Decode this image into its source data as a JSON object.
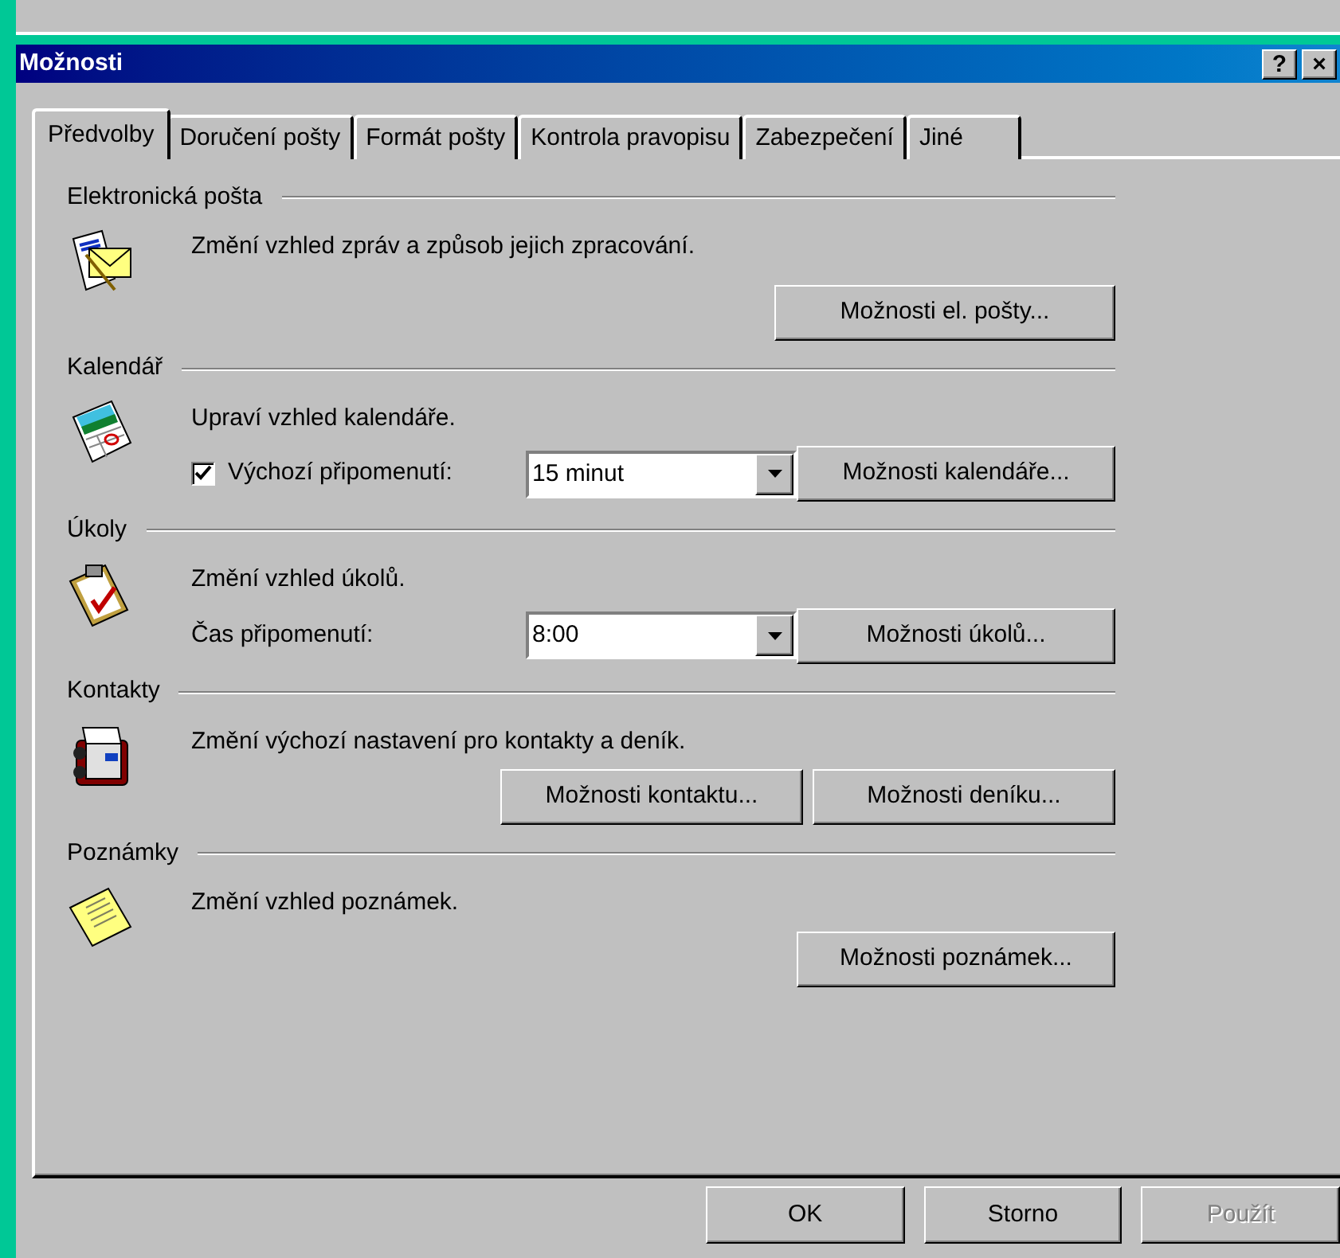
{
  "window": {
    "title": "Možnosti"
  },
  "title_buttons": [
    {
      "label": "?"
    },
    {
      "label": "×"
    }
  ],
  "tabs": [
    {
      "label": "Předvolby",
      "selected": true
    },
    {
      "label": "Doručení pošty",
      "selected": false
    },
    {
      "label": "Formát pošty",
      "selected": false
    },
    {
      "label": "Kontrola pravopisu",
      "selected": false
    },
    {
      "label": "Zabezpečení",
      "selected": false
    },
    {
      "label": "Jiné",
      "selected": false
    }
  ],
  "sections": [
    {
      "kind": "mail",
      "heading": "Elektronická pošta",
      "description": "Změní vzhled zpráv a způsob jejich zpracování.",
      "buttons": [
        {
          "label": "Možnosti el. pošty..."
        }
      ]
    },
    {
      "kind": "calendar",
      "heading": "Kalendář",
      "description": "Upraví vzhled kalendáře.",
      "reminder": {
        "kind": "checkbox",
        "label": "Výchozí připomenutí:",
        "checked": true,
        "value": "15 minut"
      },
      "buttons": [
        {
          "label": "Možnosti kalendáře..."
        }
      ]
    },
    {
      "kind": "tasks",
      "heading": "Úkoly",
      "description": "Změní vzhled úkolů.",
      "reminder": {
        "kind": "label",
        "label": "Čas připomenutí:",
        "value": "8:00"
      },
      "buttons": [
        {
          "label": "Možnosti úkolů..."
        }
      ]
    },
    {
      "kind": "contacts",
      "heading": "Kontakty",
      "description": "Změní výchozí nastavení pro kontakty a deník.",
      "buttons": [
        {
          "label": "Možnosti kontaktu..."
        },
        {
          "label": "Možnosti deníku..."
        }
      ]
    },
    {
      "kind": "notes",
      "heading": "Poznámky",
      "description": "Změní vzhled poznámek.",
      "buttons": [
        {
          "label": "Možnosti poznámek..."
        }
      ]
    }
  ],
  "dialog_buttons": [
    {
      "label": "OK",
      "disabled": false
    },
    {
      "label": "Storno",
      "disabled": false
    },
    {
      "label": "Použít",
      "disabled": true
    }
  ]
}
